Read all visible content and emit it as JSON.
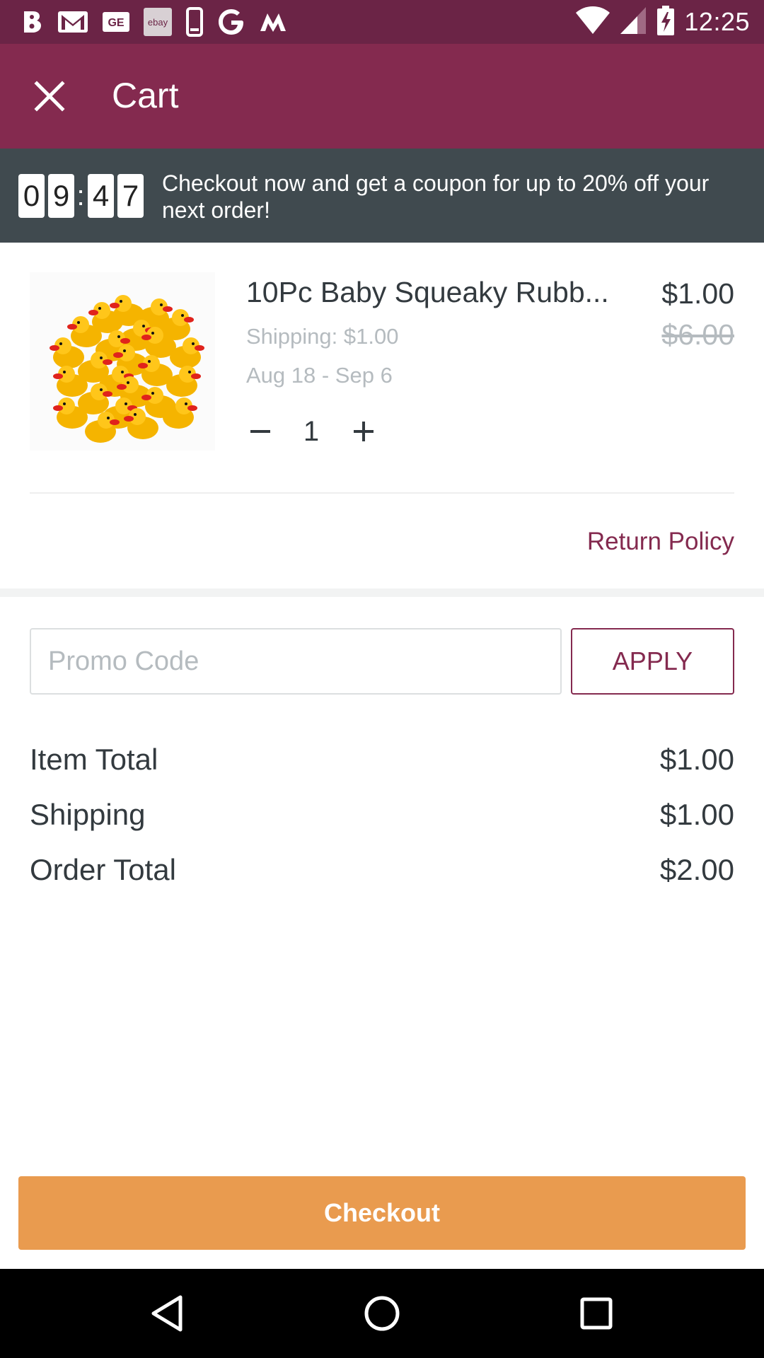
{
  "status_bar": {
    "time": "12:25",
    "notification_icons": [
      "b-icon",
      "gmail-icon",
      "ge-icon",
      "ebay-icon",
      "phone-icon",
      "google-icon",
      "m-icon"
    ],
    "ebay_label": "ebay",
    "ge_label": "GE"
  },
  "app_bar": {
    "title": "Cart",
    "close_icon": "close-icon",
    "color": "#842a4f"
  },
  "banner": {
    "timer_digits": [
      "0",
      "9",
      "4",
      "7"
    ],
    "separator": ":",
    "message": "Checkout now and get a coupon for up to 20% off your next order!"
  },
  "cart_item": {
    "name": "10Pc Baby Squeaky Rubb...",
    "price": "$1.00",
    "original_price": "$6.00",
    "shipping": "Shipping: $1.00",
    "delivery_dates": "Aug 18 - Sep 6",
    "quantity": "1",
    "image": "rubber-ducks-image"
  },
  "return_policy": "Return Policy",
  "promo": {
    "placeholder": "Promo Code",
    "value": "",
    "apply_label": "APPLY"
  },
  "totals": [
    {
      "label": "Item Total",
      "value": "$1.00"
    },
    {
      "label": "Shipping",
      "value": "$1.00"
    },
    {
      "label": "Order Total",
      "value": "$2.00"
    }
  ],
  "checkout_label": "Checkout",
  "colors": {
    "brand": "#842a4f",
    "status_bar": "#6b2446",
    "banner": "#404a4f",
    "checkout": "#e99b4f"
  }
}
